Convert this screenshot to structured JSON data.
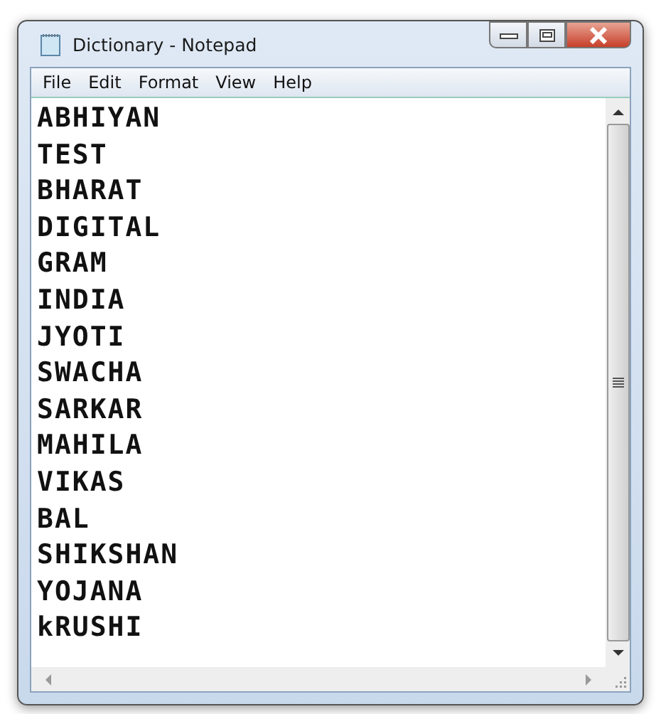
{
  "window": {
    "title": "Dictionary - Notepad"
  },
  "menu": [
    "File",
    "Edit",
    "Format",
    "View",
    "Help"
  ],
  "lines": [
    "ABHIYAN",
    "TEST",
    "BHARAT",
    "DIGITAL",
    "GRAM",
    "INDIA",
    "JYOTI",
    "SWACHA",
    "SARKAR",
    "MAHILA",
    "VIKAS",
    "BAL",
    "SHIKSHAN",
    "YOJANA",
    "kRUSHI"
  ]
}
